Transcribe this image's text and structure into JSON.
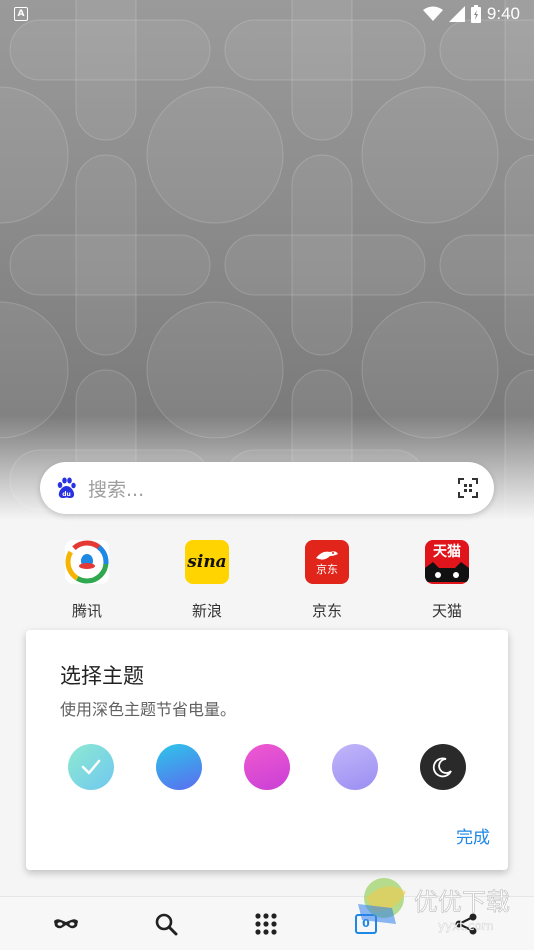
{
  "status_bar": {
    "notification_letter": "A",
    "time": "9:40"
  },
  "search": {
    "placeholder": "搜索..."
  },
  "shortcuts": [
    {
      "label": "腾讯",
      "icon": "tencent-logo-icon"
    },
    {
      "label": "新浪",
      "icon": "sina-logo-icon",
      "logo_text": "sina"
    },
    {
      "label": "京东",
      "icon": "jd-logo-icon",
      "logo_text": "京东"
    },
    {
      "label": "天猫",
      "icon": "tmall-logo-icon",
      "logo_text": "天猫"
    }
  ],
  "theme_dialog": {
    "title": "选择主题",
    "subtitle": "使用深色主题节省电量。",
    "done_label": "完成",
    "themes": [
      {
        "name": "mint",
        "selected": true,
        "colors": [
          "#8ee9d0",
          "#6fc8f0"
        ]
      },
      {
        "name": "blue",
        "selected": false,
        "colors": [
          "#2ec6e8",
          "#5a6cf0"
        ]
      },
      {
        "name": "magenta",
        "selected": false,
        "colors": [
          "#f05ad0",
          "#c93fd6"
        ]
      },
      {
        "name": "lavender",
        "selected": false,
        "colors": [
          "#c2b6fa",
          "#9a8ef2"
        ]
      },
      {
        "name": "dark",
        "selected": false,
        "colors": [
          "#2a2a2a",
          "#2a2a2a"
        ]
      }
    ]
  },
  "bottom_nav": {
    "tab_count": "0",
    "items": [
      "incognito-icon",
      "search-icon",
      "apps-grid-icon",
      "tabs-icon",
      "share-icon"
    ]
  },
  "watermark": {
    "text": "优优下载",
    "sub_text": "yyxt.com"
  },
  "colors": {
    "accent": "#1e88e5",
    "baidu_blue": "#2932e1"
  }
}
